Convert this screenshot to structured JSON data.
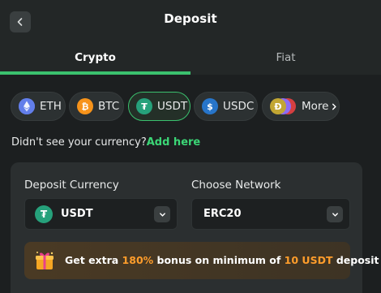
{
  "header": {
    "title": "Deposit"
  },
  "tabs": [
    {
      "label": "Crypto",
      "active": true
    },
    {
      "label": "Fiat",
      "active": false
    }
  ],
  "currencies": [
    {
      "label": "ETH",
      "icon": "eth-icon",
      "color": "#627eea"
    },
    {
      "label": "BTC",
      "icon": "btc-icon",
      "color": "#f7931a"
    },
    {
      "label": "USDT",
      "icon": "usdt-icon",
      "color": "#26a17b",
      "selected": true
    },
    {
      "label": "USDC",
      "icon": "usdc-icon",
      "color": "#2775ca"
    },
    {
      "label": "More",
      "icon": "more-coins-icon"
    }
  ],
  "notice": {
    "text": "Didn't see your currency?",
    "link": "Add here"
  },
  "form": {
    "currency_label": "Deposit Currency",
    "currency_value": "USDT",
    "network_label": "Choose Network",
    "network_value": "ERC20"
  },
  "bonus": {
    "p1": "Get extra ",
    "percent": "180%",
    "p2": " bonus on minimum of ",
    "amount": "10 USDT",
    "p3": " deposit"
  },
  "colors": {
    "accent": "#3bc16e",
    "highlight": "#ff9d2b"
  }
}
